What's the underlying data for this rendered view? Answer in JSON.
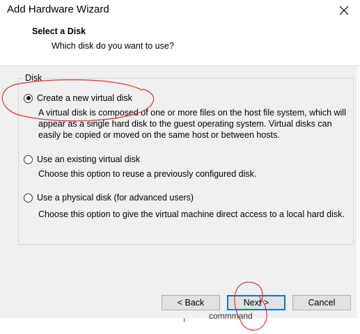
{
  "window": {
    "title": "Add Hardware Wizard",
    "close_icon": "close-icon"
  },
  "header": {
    "title": "Select a Disk",
    "subtitle": "Which disk do you want to use?"
  },
  "group": {
    "label": "Disk"
  },
  "options": [
    {
      "label": "Create a new virtual disk",
      "selected": true,
      "description": "A virtual disk is composed of one or more files on the host file system, which will appear as a single hard disk to the guest operating system. Virtual disks can easily be copied or moved on the same host or between hosts."
    },
    {
      "label": "Use an existing virtual disk",
      "selected": false,
      "description": "Choose this option to reuse a previously configured disk."
    },
    {
      "label": "Use a physical disk (for advanced users)",
      "selected": false,
      "description": "Choose this option to give the virtual machine direct access to a local hard disk."
    }
  ],
  "buttons": {
    "back": "< Back",
    "next": "Next >",
    "cancel": "Cancel"
  },
  "footer": {
    "stray_text": "commmand"
  },
  "colors": {
    "annotation_ink": "#e03030",
    "default_button_border": "#0078d7",
    "dialog_background": "#f0f0f0"
  }
}
